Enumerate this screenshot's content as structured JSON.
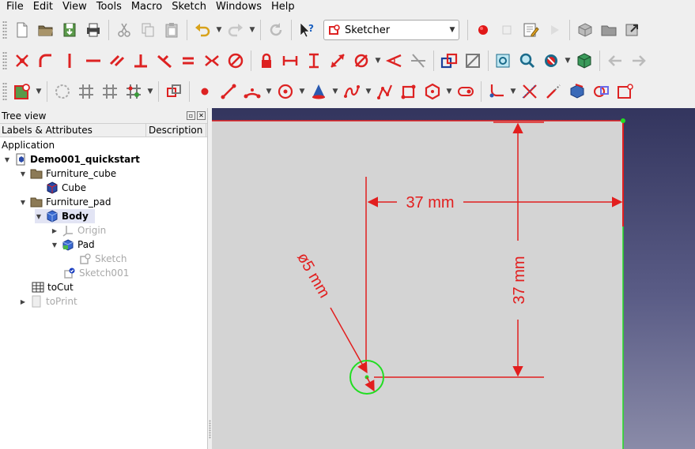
{
  "menubar": {
    "items": [
      {
        "label": "File"
      },
      {
        "label": "Edit"
      },
      {
        "label": "View"
      },
      {
        "label": "Tools"
      },
      {
        "label": "Macro"
      },
      {
        "label": "Sketch"
      },
      {
        "label": "Windows"
      },
      {
        "label": "Help"
      }
    ]
  },
  "toolbar": {
    "workbench_selected": "Sketcher"
  },
  "tree_panel": {
    "title": "Tree view",
    "columns": [
      "Labels & Attributes",
      "Description"
    ],
    "items": [
      {
        "label": "Application"
      },
      {
        "label": "Demo001_quickstart"
      },
      {
        "label": "Furniture_cube"
      },
      {
        "label": "Cube"
      },
      {
        "label": "Furniture_pad"
      },
      {
        "label": "Body"
      },
      {
        "label": "Origin"
      },
      {
        "label": "Pad"
      },
      {
        "label": "Sketch"
      },
      {
        "label": "Sketch001"
      },
      {
        "label": "toCut"
      },
      {
        "label": "toPrint"
      }
    ]
  },
  "sketch_view": {
    "dim_horizontal": "37 mm",
    "dim_vertical": "37 mm",
    "dim_diameter": "ø5 mm",
    "colors": {
      "constraint": "#e21e1e",
      "circle": "#22dd22",
      "sketch_face": "#d4d4d4",
      "bg_top": "#33355e",
      "bg_bottom": "#8a8ba8"
    }
  }
}
